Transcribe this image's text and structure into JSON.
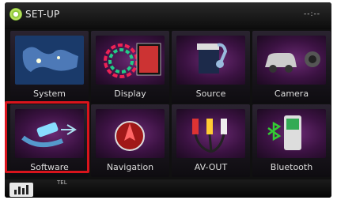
{
  "header": {
    "title": "SET-UP",
    "clock": "--:--",
    "settings_icon": "gear-icon"
  },
  "menu": [
    {
      "label": "System",
      "icon": "world-map-icon"
    },
    {
      "label": "Display",
      "icon": "display-icon"
    },
    {
      "label": "Source",
      "icon": "clapperboard-music-icon"
    },
    {
      "label": "Camera",
      "icon": "car-camera-icon"
    },
    {
      "label": "Software",
      "icon": "usb-software-icon",
      "selected": true
    },
    {
      "label": "Navigation",
      "icon": "navigation-icon"
    },
    {
      "label": "AV-OUT",
      "icon": "av-cables-icon"
    },
    {
      "label": "Bluetooth",
      "icon": "bluetooth-phone-icon"
    }
  ],
  "footer": {
    "eq_icon": "equalizer-icon",
    "tel": "TEL"
  },
  "colors": {
    "selection": "#d9141c",
    "tile_bg": "#3b1242"
  }
}
